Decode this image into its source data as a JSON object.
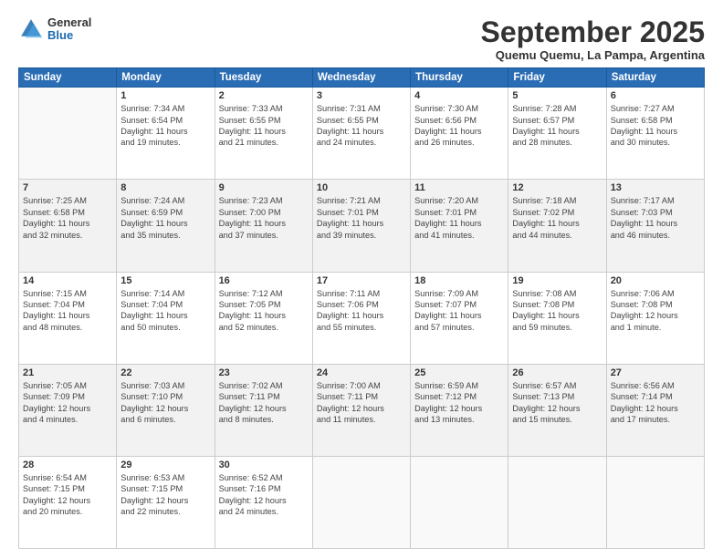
{
  "logo": {
    "general": "General",
    "blue": "Blue"
  },
  "title": "September 2025",
  "subtitle": "Quemu Quemu, La Pampa, Argentina",
  "days": [
    "Sunday",
    "Monday",
    "Tuesday",
    "Wednesday",
    "Thursday",
    "Friday",
    "Saturday"
  ],
  "weeks": [
    [
      {
        "day": "",
        "content": ""
      },
      {
        "day": "1",
        "content": "Sunrise: 7:34 AM\nSunset: 6:54 PM\nDaylight: 11 hours\nand 19 minutes."
      },
      {
        "day": "2",
        "content": "Sunrise: 7:33 AM\nSunset: 6:55 PM\nDaylight: 11 hours\nand 21 minutes."
      },
      {
        "day": "3",
        "content": "Sunrise: 7:31 AM\nSunset: 6:55 PM\nDaylight: 11 hours\nand 24 minutes."
      },
      {
        "day": "4",
        "content": "Sunrise: 7:30 AM\nSunset: 6:56 PM\nDaylight: 11 hours\nand 26 minutes."
      },
      {
        "day": "5",
        "content": "Sunrise: 7:28 AM\nSunset: 6:57 PM\nDaylight: 11 hours\nand 28 minutes."
      },
      {
        "day": "6",
        "content": "Sunrise: 7:27 AM\nSunset: 6:58 PM\nDaylight: 11 hours\nand 30 minutes."
      }
    ],
    [
      {
        "day": "7",
        "content": "Sunrise: 7:25 AM\nSunset: 6:58 PM\nDaylight: 11 hours\nand 32 minutes."
      },
      {
        "day": "8",
        "content": "Sunrise: 7:24 AM\nSunset: 6:59 PM\nDaylight: 11 hours\nand 35 minutes."
      },
      {
        "day": "9",
        "content": "Sunrise: 7:23 AM\nSunset: 7:00 PM\nDaylight: 11 hours\nand 37 minutes."
      },
      {
        "day": "10",
        "content": "Sunrise: 7:21 AM\nSunset: 7:01 PM\nDaylight: 11 hours\nand 39 minutes."
      },
      {
        "day": "11",
        "content": "Sunrise: 7:20 AM\nSunset: 7:01 PM\nDaylight: 11 hours\nand 41 minutes."
      },
      {
        "day": "12",
        "content": "Sunrise: 7:18 AM\nSunset: 7:02 PM\nDaylight: 11 hours\nand 44 minutes."
      },
      {
        "day": "13",
        "content": "Sunrise: 7:17 AM\nSunset: 7:03 PM\nDaylight: 11 hours\nand 46 minutes."
      }
    ],
    [
      {
        "day": "14",
        "content": "Sunrise: 7:15 AM\nSunset: 7:04 PM\nDaylight: 11 hours\nand 48 minutes."
      },
      {
        "day": "15",
        "content": "Sunrise: 7:14 AM\nSunset: 7:04 PM\nDaylight: 11 hours\nand 50 minutes."
      },
      {
        "day": "16",
        "content": "Sunrise: 7:12 AM\nSunset: 7:05 PM\nDaylight: 11 hours\nand 52 minutes."
      },
      {
        "day": "17",
        "content": "Sunrise: 7:11 AM\nSunset: 7:06 PM\nDaylight: 11 hours\nand 55 minutes."
      },
      {
        "day": "18",
        "content": "Sunrise: 7:09 AM\nSunset: 7:07 PM\nDaylight: 11 hours\nand 57 minutes."
      },
      {
        "day": "19",
        "content": "Sunrise: 7:08 AM\nSunset: 7:08 PM\nDaylight: 11 hours\nand 59 minutes."
      },
      {
        "day": "20",
        "content": "Sunrise: 7:06 AM\nSunset: 7:08 PM\nDaylight: 12 hours\nand 1 minute."
      }
    ],
    [
      {
        "day": "21",
        "content": "Sunrise: 7:05 AM\nSunset: 7:09 PM\nDaylight: 12 hours\nand 4 minutes."
      },
      {
        "day": "22",
        "content": "Sunrise: 7:03 AM\nSunset: 7:10 PM\nDaylight: 12 hours\nand 6 minutes."
      },
      {
        "day": "23",
        "content": "Sunrise: 7:02 AM\nSunset: 7:11 PM\nDaylight: 12 hours\nand 8 minutes."
      },
      {
        "day": "24",
        "content": "Sunrise: 7:00 AM\nSunset: 7:11 PM\nDaylight: 12 hours\nand 11 minutes."
      },
      {
        "day": "25",
        "content": "Sunrise: 6:59 AM\nSunset: 7:12 PM\nDaylight: 12 hours\nand 13 minutes."
      },
      {
        "day": "26",
        "content": "Sunrise: 6:57 AM\nSunset: 7:13 PM\nDaylight: 12 hours\nand 15 minutes."
      },
      {
        "day": "27",
        "content": "Sunrise: 6:56 AM\nSunset: 7:14 PM\nDaylight: 12 hours\nand 17 minutes."
      }
    ],
    [
      {
        "day": "28",
        "content": "Sunrise: 6:54 AM\nSunset: 7:15 PM\nDaylight: 12 hours\nand 20 minutes."
      },
      {
        "day": "29",
        "content": "Sunrise: 6:53 AM\nSunset: 7:15 PM\nDaylight: 12 hours\nand 22 minutes."
      },
      {
        "day": "30",
        "content": "Sunrise: 6:52 AM\nSunset: 7:16 PM\nDaylight: 12 hours\nand 24 minutes."
      },
      {
        "day": "",
        "content": ""
      },
      {
        "day": "",
        "content": ""
      },
      {
        "day": "",
        "content": ""
      },
      {
        "day": "",
        "content": ""
      }
    ]
  ]
}
